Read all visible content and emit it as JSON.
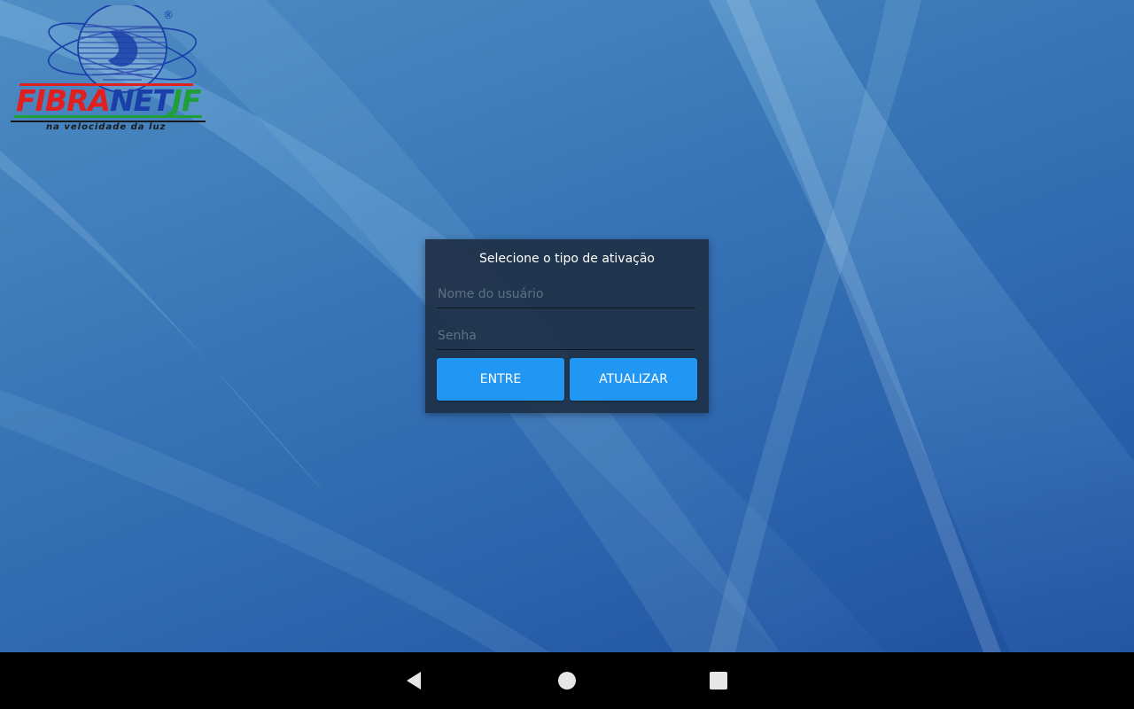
{
  "logo": {
    "brand_red": "FIBRA",
    "brand_blue": "NET",
    "brand_green": "JF",
    "tagline": "na velocidade da luz",
    "registered": "®"
  },
  "dialog": {
    "title": "Selecione o tipo de ativação",
    "username_placeholder": "Nome do usuário",
    "password_placeholder": "Senha",
    "username_value": "",
    "password_value": "",
    "enter_label": "ENTRE",
    "update_label": "ATUALIZAR"
  },
  "navigation": {
    "back_icon": "back-triangle-icon",
    "home_icon": "home-circle-icon",
    "recent_icon": "recent-apps-square-icon"
  },
  "colors": {
    "button": "#2196f3",
    "dialog_bg": "#1e3046",
    "navbar": "#000000",
    "brand_red": "#e02020",
    "brand_blue": "#1a3fa8",
    "brand_green": "#1f9e3a"
  }
}
